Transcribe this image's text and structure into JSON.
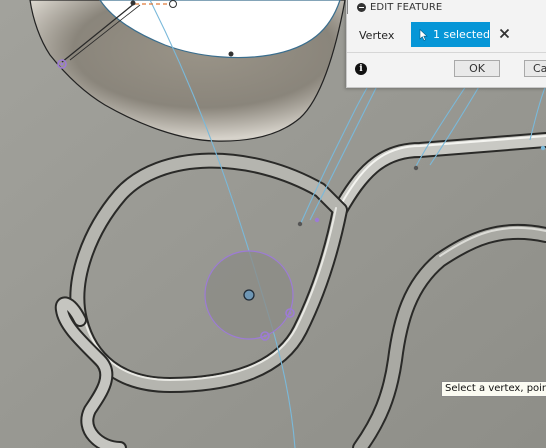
{
  "panel": {
    "title": "EDIT FEATURE",
    "selection_label": "Vertex",
    "selection_button": "1 selected",
    "ok_label": "OK",
    "cancel_label": "Ca",
    "info_symbol": "i"
  },
  "tooltip": {
    "text": "Select a vertex, point"
  },
  "colors": {
    "viewport_bg": "#9a9a94",
    "accent_blue": "#0696d7",
    "sketch_line": "#7ab9da",
    "selection_purple": "#9d7bd6",
    "dimension_orange": "#e07b39"
  },
  "icons": {
    "collapse": "minus-circle-icon",
    "selection_cursor": "cursor-arrow-icon",
    "clear": "close-icon",
    "info": "info-icon"
  }
}
